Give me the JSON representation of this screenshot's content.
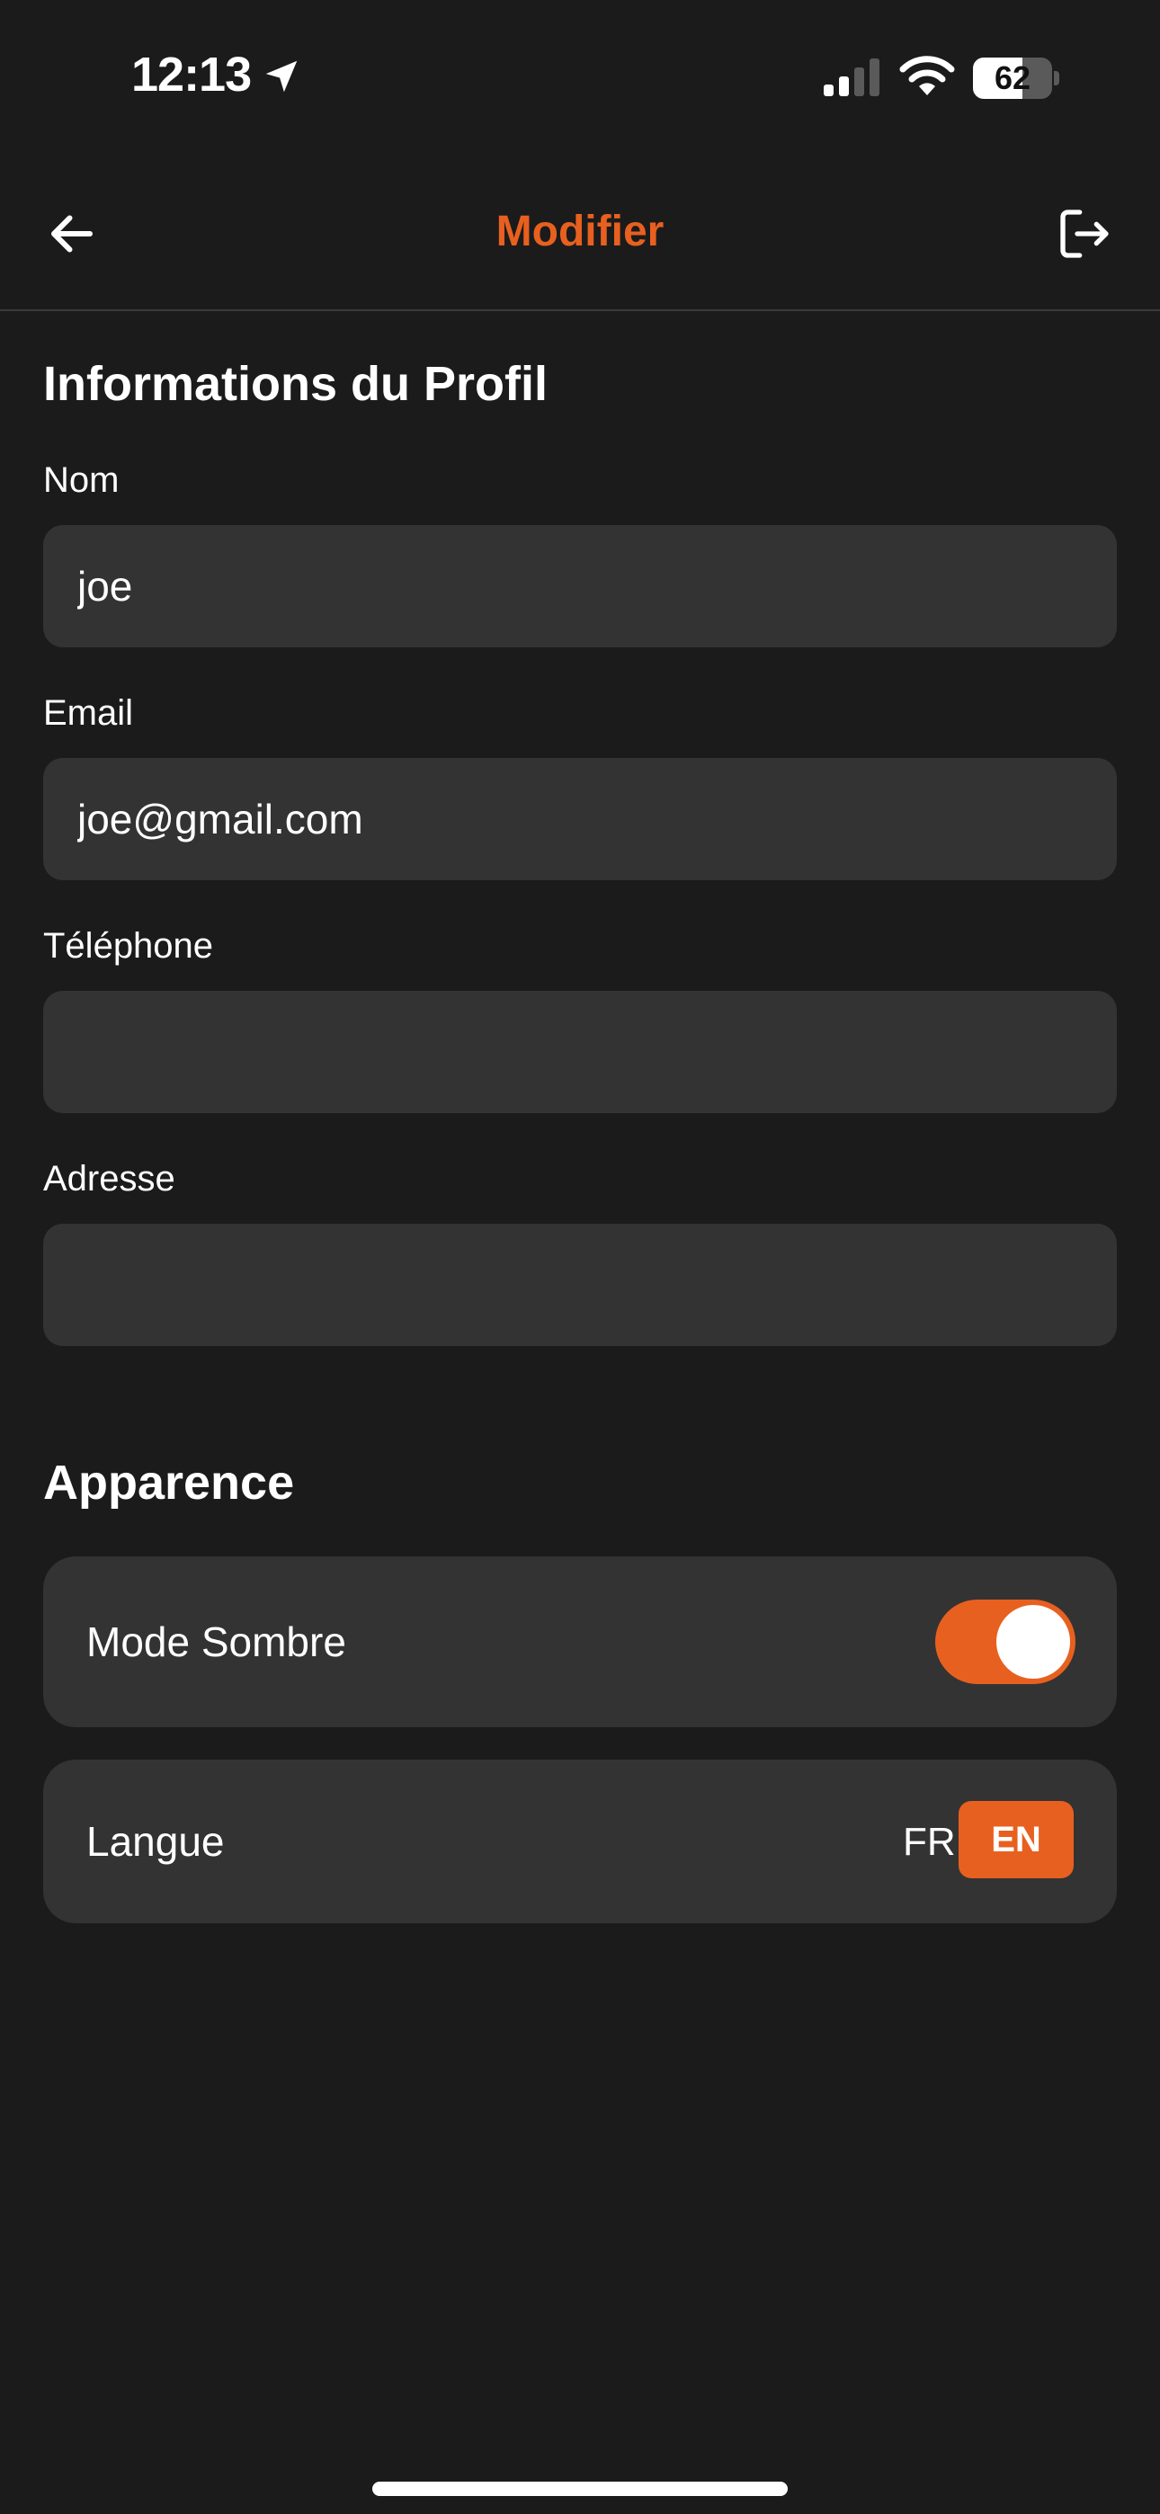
{
  "status_bar": {
    "time": "12:13",
    "battery_percent": "62",
    "battery_level": 0.62,
    "location_icon": "location-arrow-icon",
    "signal_icon": "cellular-signal-icon",
    "wifi_icon": "wifi-icon"
  },
  "nav": {
    "title": "Modifier",
    "back_icon": "arrow-left-icon",
    "logout_icon": "logout-icon"
  },
  "profile": {
    "section_title": "Informations du Profil",
    "fields": [
      {
        "label": "Nom",
        "value": "joe",
        "placeholder": ""
      },
      {
        "label": "Email",
        "value": "joe@gmail.com",
        "placeholder": ""
      },
      {
        "label": "Téléphone",
        "value": "",
        "placeholder": ""
      },
      {
        "label": "Adresse",
        "value": "",
        "placeholder": ""
      }
    ]
  },
  "appearance": {
    "section_title": "Apparence",
    "dark_mode": {
      "label": "Mode Sombre",
      "enabled": true
    },
    "language": {
      "label": "Langue",
      "options": [
        "FR",
        "EN"
      ],
      "selected": "EN"
    }
  },
  "colors": {
    "accent": "#e8601f",
    "background": "#1b1b1b",
    "surface": "#333333",
    "text": "#ffffff"
  }
}
